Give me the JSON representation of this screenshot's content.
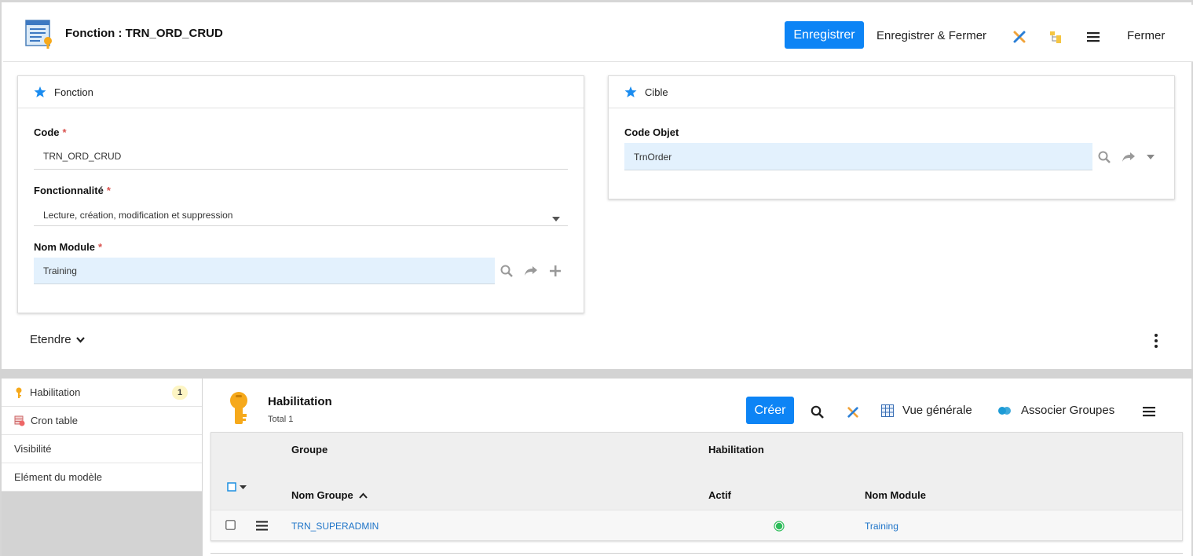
{
  "header": {
    "title": "Fonction : TRN_ORD_CRUD",
    "save_label": "Enregistrer",
    "save_close_label": "Enregistrer & Fermer",
    "close_label": "Fermer",
    "icons": [
      "tools-icon",
      "hierarchy-icon",
      "menu-icon"
    ]
  },
  "fonction_panel": {
    "title": "Fonction",
    "code_label": "Code",
    "code_value": "TRN_ORD_CRUD",
    "fonctionnalite_label": "Fonctionnalité",
    "fonctionnalite_value": "Lecture, création, modification et suppression",
    "module_label": "Nom Module",
    "module_value": "Training",
    "required_mark": "*"
  },
  "cible_panel": {
    "title": "Cible",
    "code_objet_label": "Code Objet",
    "code_objet_value": "TrnOrder"
  },
  "expand_label": "Etendre",
  "sidebar": {
    "items": [
      {
        "label": "Habilitation",
        "badge": "1"
      },
      {
        "label": "Cron table"
      },
      {
        "label": "Visibilité"
      },
      {
        "label": "Elément du modèle"
      }
    ]
  },
  "grid": {
    "title": "Habilitation",
    "subtitle": "Total 1",
    "create_label": "Créer",
    "overview_label": "Vue générale",
    "associate_label": "Associer Groupes",
    "group_header": "Groupe",
    "habilitation_header": "Habilitation",
    "columns": [
      "Nom Groupe",
      "Actif",
      "Nom Module"
    ],
    "rows": [
      {
        "group": "TRN_SUPERADMIN",
        "active": true,
        "module": "Training"
      }
    ]
  },
  "colors": {
    "primary": "#0d84f5",
    "field_bg": "#e3f1fd",
    "link": "#1e74c8",
    "active_dot": "#2dbd5a"
  }
}
